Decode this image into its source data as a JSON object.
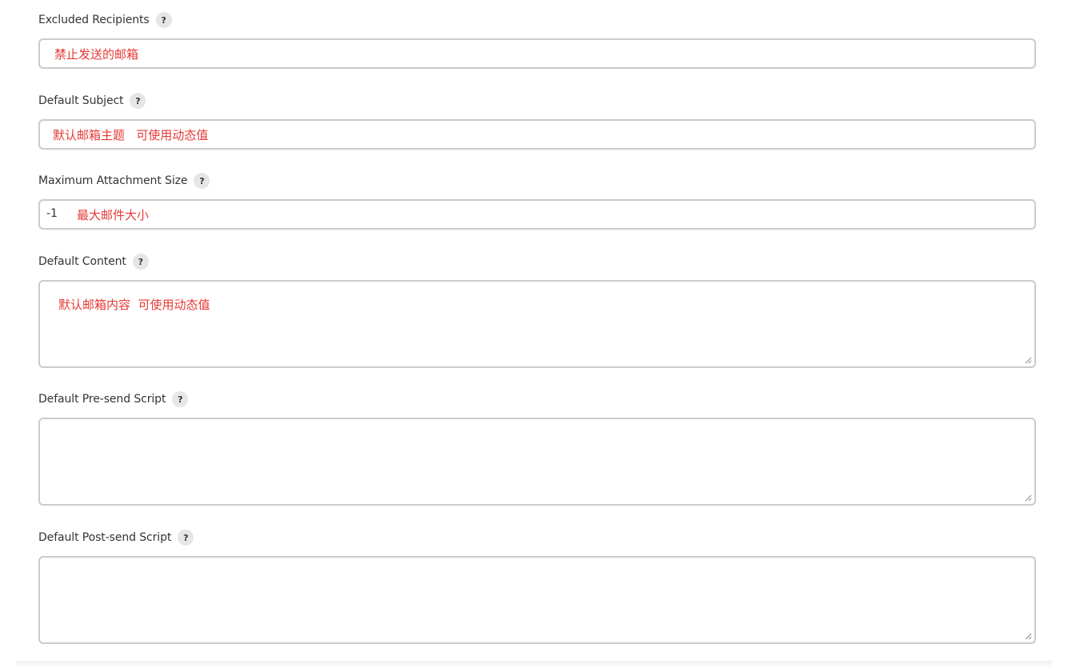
{
  "fields": {
    "excluded_recipients": {
      "label": "Excluded Recipients",
      "help": "?",
      "value": "禁止发送的邮箱"
    },
    "default_subject": {
      "label": "Default Subject",
      "help": "?",
      "value": "默认邮箱主题   可使用动态值"
    },
    "max_attachment_size": {
      "label": "Maximum Attachment Size",
      "help": "?",
      "value_number": "-1",
      "value_note": "最大邮件大小"
    },
    "default_content": {
      "label": "Default Content",
      "help": "?",
      "value": "默认邮箱内容  可使用动态值"
    },
    "default_presend_script": {
      "label": "Default Pre-send Script",
      "help": "?",
      "value": ""
    },
    "default_postsend_script": {
      "label": "Default Post-send Script",
      "help": "?",
      "value": ""
    }
  },
  "colors": {
    "annotation_red": "#e53935",
    "border": "#c6ccd1",
    "help_bg": "#e6e6e6"
  }
}
